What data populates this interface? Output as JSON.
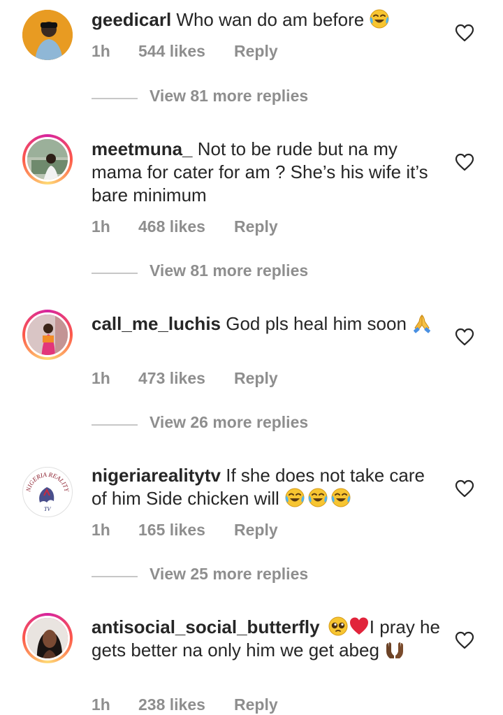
{
  "colors": {
    "text": "#262626",
    "muted": "#8e8e8e",
    "divider": "#c7c7c7",
    "heart": "#262626"
  },
  "comments": [
    {
      "username": "geedicarl",
      "text": "Who wan do am before",
      "emojis": [
        "laugh-cry"
      ],
      "time": "1h",
      "likes": "544 likes",
      "reply": "Reply",
      "view_replies": "View 81 more replies",
      "avatar": "photo"
    },
    {
      "username": "meetmuna_",
      "text": "Not to be rude but na my mama for cater for am ? She’s his wife it’s bare minimum",
      "emojis": [],
      "time": "1h",
      "likes": "468 likes",
      "reply": "Reply",
      "view_replies": "View 81 more replies",
      "avatar": "story-ring"
    },
    {
      "username": "call_me_luchis",
      "text": "God pls heal him soon",
      "emojis": [
        "folded-hands"
      ],
      "time": "1h",
      "likes": "473 likes",
      "reply": "Reply",
      "view_replies": "View 26 more replies",
      "avatar": "story-ring"
    },
    {
      "username": "nigeriarealitytv",
      "text": "If she does not take care of him Side chicken will",
      "emojis": [
        "laugh-cry",
        "laugh-cry",
        "laugh-cry"
      ],
      "time": "1h",
      "likes": "165 likes",
      "reply": "Reply",
      "view_replies": "View 25 more replies",
      "avatar": "logo",
      "logo_text": "NIGERIA REALITY TV"
    },
    {
      "username": "antisocial_social_butterfly",
      "text": "I pray he gets better na only him we get abeg",
      "emojis": [
        "pleading-face",
        "red-heart",
        "palms-up"
      ],
      "time": "1h",
      "likes": "238 likes",
      "reply": "Reply",
      "avatar": "story-ring"
    }
  ]
}
